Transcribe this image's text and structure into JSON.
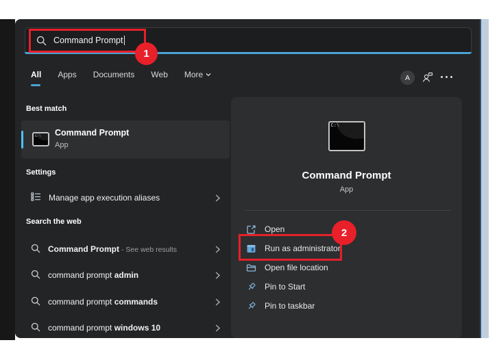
{
  "colors": {
    "accent_blue": "#4cc2ff",
    "underline_blue": "#4aa3d6",
    "annotation_red": "#e7202a",
    "panel_bg": "#232425",
    "preview_card_bg": "#2d2e30",
    "icon_blue": "#7fb2dd"
  },
  "search_bar": {
    "value": "Command Prompt",
    "icon": "search-icon"
  },
  "tabs": {
    "items": [
      {
        "label": "All",
        "active": true
      },
      {
        "label": "Apps",
        "active": false
      },
      {
        "label": "Documents",
        "active": false
      },
      {
        "label": "Web",
        "active": false
      },
      {
        "label": "More",
        "active": false,
        "dropdown": true
      }
    ]
  },
  "header": {
    "avatar_letter": "A",
    "icons": [
      "avatar",
      "people-window-icon",
      "more-ellipsis-icon"
    ]
  },
  "left_panel": {
    "best_match": {
      "heading": "Best match",
      "item": {
        "title": "Command Prompt",
        "subtitle": "App",
        "icon": "cmd-window-icon"
      }
    },
    "settings": {
      "heading": "Settings",
      "items": [
        {
          "label": "Manage app execution aliases",
          "icon": "list-settings-icon"
        }
      ]
    },
    "search_web": {
      "heading": "Search the web",
      "items": [
        {
          "lead": "",
          "strong": "Command Prompt",
          "tail": " - See web results",
          "icon": "search-icon"
        },
        {
          "lead": "command prompt ",
          "strong": "admin",
          "tail": "",
          "icon": "search-icon"
        },
        {
          "lead": "command prompt ",
          "strong": "commands",
          "tail": "",
          "icon": "search-icon"
        },
        {
          "lead": "command prompt ",
          "strong": "windows 10",
          "tail": "",
          "icon": "search-icon"
        }
      ]
    }
  },
  "preview_panel": {
    "title": "Command Prompt",
    "subtitle": "App",
    "icon": "cmd-window-icon",
    "actions": [
      {
        "label": "Open",
        "icon": "open-external-icon"
      },
      {
        "label": "Run as administrator",
        "icon": "admin-window-icon"
      },
      {
        "label": "Open file location",
        "icon": "folder-icon"
      },
      {
        "label": "Pin to Start",
        "icon": "pin-icon"
      },
      {
        "label": "Pin to taskbar",
        "icon": "pin-icon"
      }
    ]
  },
  "annotations": {
    "step1": "1",
    "step2": "2"
  },
  "icons_misc": {
    "cmd_screen_text": "C:\\"
  }
}
